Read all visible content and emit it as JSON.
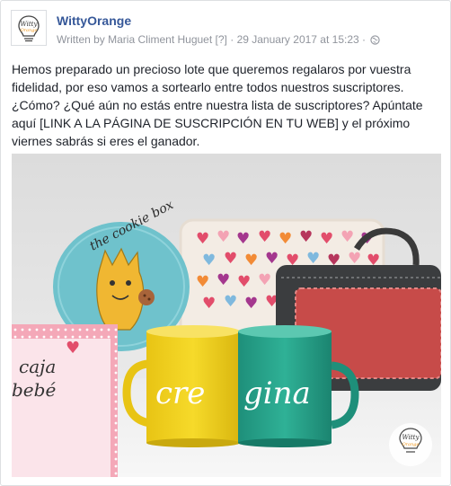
{
  "post": {
    "page_name": "WittyOrange",
    "byline_prefix": "Written by",
    "author": "Maria Climent Huguet",
    "author_badge": "[?]",
    "separator": "·",
    "timestamp": "29 January 2017 at 15:23",
    "separator2": "·",
    "privacy_icon": "globe-icon",
    "text_lines": [
      "Hemos preparado un precioso lote que queremos regalaros por vuestra",
      "fidelidad, por eso vamos a sortearlo entre todos nuestros suscriptores.",
      "¿Cómo? ¿Qué aún no estás entre nuestra lista de suscriptores? Apúntate",
      "aquí [LINK A LA PÁGINA DE SUSCRIPCIÓN EN TU WEB] y el próximo",
      "viernes sabrás si eres el ganador."
    ]
  },
  "avatar": {
    "logo_top": "Witty",
    "logo_bottom": "Orange"
  },
  "photo": {
    "plate_text": "the cookie box",
    "box_text_1": "caja",
    "box_text_2": "bebé",
    "mug_text_1": "cre",
    "mug_text_2": "gina",
    "watermark_top": "Witty",
    "watermark_bottom": "Orange"
  },
  "colors": {
    "link": "#365899",
    "meta": "#90949c",
    "yellow_mug": "#f2d21b",
    "teal_mug": "#28a48c",
    "plate": "#6fc2cc",
    "bag": "#c74b49",
    "brand_orange": "#f29a1f"
  }
}
